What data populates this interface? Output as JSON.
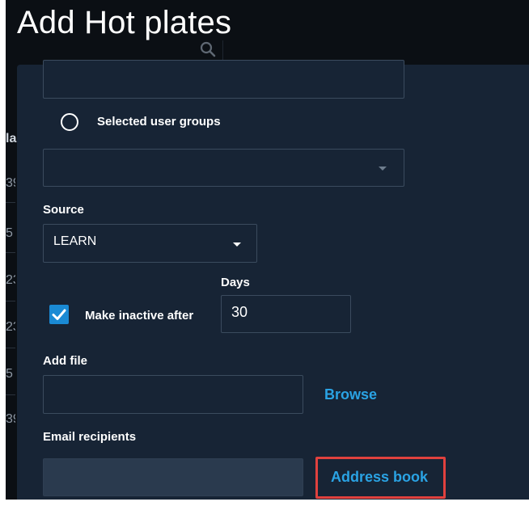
{
  "page": {
    "title": "Add Hot plates"
  },
  "background": {
    "column_header": "la",
    "row_fragments": [
      "39",
      "5",
      "23",
      "23",
      "5",
      "39"
    ]
  },
  "form": {
    "audience_option_label": "Selected user groups",
    "audience_option_selected": false,
    "user_groups_select_value": "",
    "source": {
      "label": "Source",
      "value": "LEARN"
    },
    "inactive": {
      "checkbox_label": "Make inactive after",
      "checked": true,
      "days_label": "Days",
      "days_value": "30"
    },
    "add_file": {
      "label": "Add file",
      "value": "",
      "browse_label": "Browse"
    },
    "email": {
      "label": "Email recipients",
      "value": "",
      "address_book_label": "Address book"
    }
  },
  "colors": {
    "backdrop": "#0b0f14",
    "panel": "#172435",
    "field_border": "#3b4b5e",
    "accent": "#1a8ad4",
    "link": "#2aa3e4",
    "highlight": "#e0413e"
  },
  "icons": {
    "search": "search-icon",
    "dropdown": "caret-down-icon",
    "check": "checkmark-icon",
    "radio": "radio-button-icon"
  }
}
